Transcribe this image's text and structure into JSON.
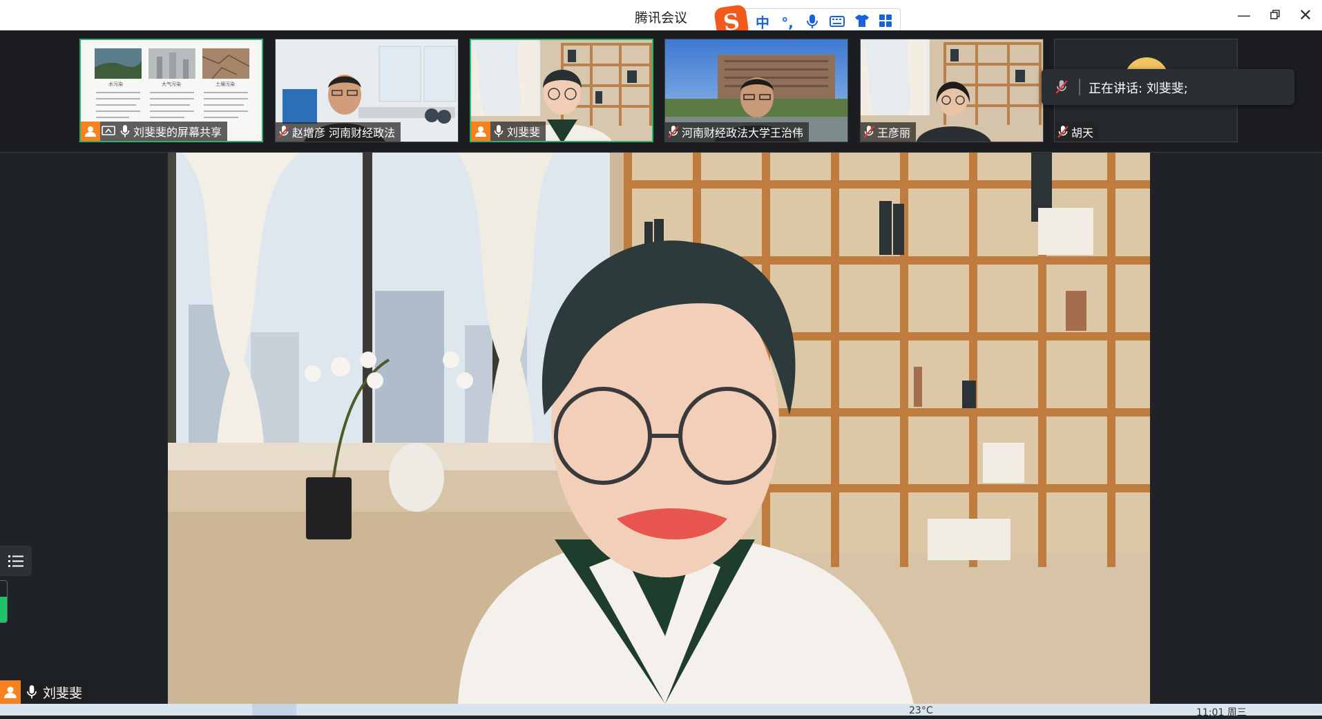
{
  "window": {
    "title": "腾讯会议"
  },
  "ime": {
    "logo": "S",
    "mode": "中",
    "punct": "°,"
  },
  "thumbnails": [
    {
      "name": "刘斐斐的屏幕共享",
      "host": true,
      "share": true,
      "mic": "on",
      "active": true,
      "slide": {
        "col1": "水污染",
        "col2": "大气污染",
        "col3": "土壤污染"
      }
    },
    {
      "name": "赵增彦 河南财经政法",
      "host": false,
      "mic": "muted",
      "active": false
    },
    {
      "name": "刘斐斐",
      "host": true,
      "mic": "on",
      "active": true
    },
    {
      "name": "河南财经政法大学王治伟",
      "host": false,
      "mic": "muted",
      "active": false
    },
    {
      "name": "王彦丽",
      "host": false,
      "mic": "muted",
      "active": false
    },
    {
      "name": "胡天",
      "host": false,
      "mic": "muted",
      "active": false
    }
  ],
  "speaking": {
    "label": "正在讲话: 刘斐斐;"
  },
  "main": {
    "name": "刘斐斐",
    "volume_level": 0.62
  },
  "taskbar": {
    "temperature": "23°C",
    "time": "11:01 周三"
  },
  "colors": {
    "active_border": "#29b36b",
    "host_badge": "#f6821f",
    "mic_on": "#21c26b",
    "mic_muted": "#e0393e"
  }
}
